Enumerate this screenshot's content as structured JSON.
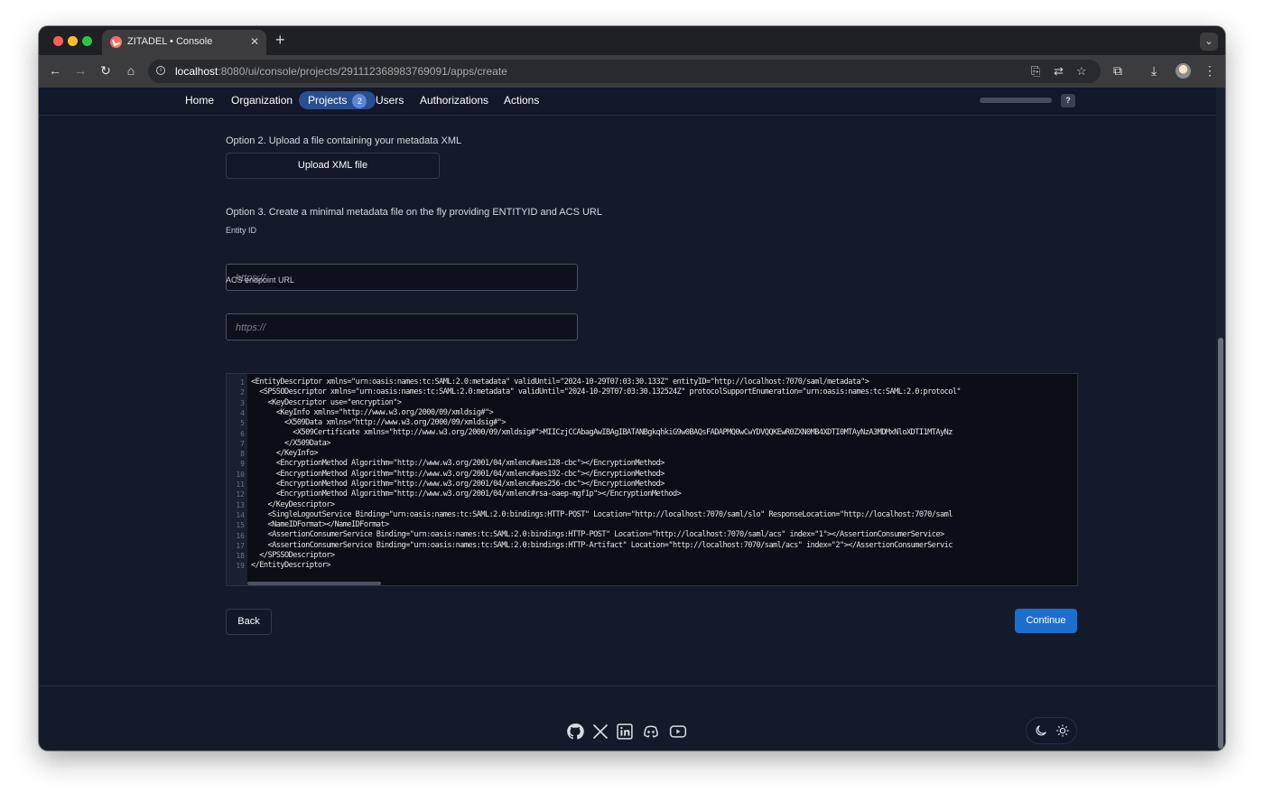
{
  "browser": {
    "tab_title": "ZITADEL • Console",
    "new_tab": "+",
    "url_host": "localhost",
    "url_path": ":8080/ui/console/projects/291112368983769091/apps/create"
  },
  "nav": {
    "items": [
      "Home",
      "Organization",
      "Projects",
      "Users",
      "Authorizations",
      "Actions"
    ],
    "projects_badge": "2",
    "help": "?"
  },
  "option2": {
    "label": "Option 2. Upload a file containing your metadata XML",
    "button": "Upload XML file"
  },
  "option3": {
    "label": "Option 3. Create a minimal metadata file on the fly providing ENTITYID and ACS URL",
    "entity_label": "Entity ID",
    "entity_placeholder": "https://",
    "acs_label": "ACS endpoint URL",
    "acs_placeholder": "https://"
  },
  "editor": {
    "line_numbers": [
      "1",
      "2",
      "3",
      "4",
      "5",
      "6",
      "7",
      "8",
      "9",
      "10",
      "11",
      "12",
      "13",
      "14",
      "15",
      "16",
      "17",
      "18",
      "19"
    ],
    "lines": [
      "<EntityDescriptor xmlns=\"urn:oasis:names:tc:SAML:2.0:metadata\" validUntil=\"2024-10-29T07:03:30.133Z\" entityID=\"http://localhost:7070/saml/metadata\">",
      "  <SPSSODescriptor xmlns=\"urn:oasis:names:tc:SAML:2.0:metadata\" validUntil=\"2024-10-29T07:03:30.132524Z\" protocolSupportEnumeration=\"urn:oasis:names:tc:SAML:2.0:protocol\"",
      "    <KeyDescriptor use=\"encryption\">",
      "      <KeyInfo xmlns=\"http://www.w3.org/2000/09/xmldsig#\">",
      "        <X509Data xmlns=\"http://www.w3.org/2000/09/xmldsig#\">",
      "          <X509Certificate xmlns=\"http://www.w3.org/2000/09/xmldsig#\">MIICzjCCAbagAwIBAgIBATANBgkqhkiG9w0BAQsFADAPMQ0wCwYDVQQKEwR0ZXN0MB4XDTI0MTAyNzA3MDMxNloXDTI1MTAyNz",
      "        </X509Data>",
      "      </KeyInfo>",
      "      <EncryptionMethod Algorithm=\"http://www.w3.org/2001/04/xmlenc#aes128-cbc\"></EncryptionMethod>",
      "      <EncryptionMethod Algorithm=\"http://www.w3.org/2001/04/xmlenc#aes192-cbc\"></EncryptionMethod>",
      "      <EncryptionMethod Algorithm=\"http://www.w3.org/2001/04/xmlenc#aes256-cbc\"></EncryptionMethod>",
      "      <EncryptionMethod Algorithm=\"http://www.w3.org/2001/04/xmlenc#rsa-oaep-mgf1p\"></EncryptionMethod>",
      "    </KeyDescriptor>",
      "    <SingleLogoutService Binding=\"urn:oasis:names:tc:SAML:2.0:bindings:HTTP-POST\" Location=\"http://localhost:7070/saml/slo\" ResponseLocation=\"http://localhost:7070/saml",
      "    <NameIDFormat></NameIDFormat>",
      "    <AssertionConsumerService Binding=\"urn:oasis:names:tc:SAML:2.0:bindings:HTTP-POST\" Location=\"http://localhost:7070/saml/acs\" index=\"1\"></AssertionConsumerService>",
      "    <AssertionConsumerService Binding=\"urn:oasis:names:tc:SAML:2.0:bindings:HTTP-Artifact\" Location=\"http://localhost:7070/saml/acs\" index=\"2\"></AssertionConsumerServic",
      "  </SPSSODescriptor>",
      "</EntityDescriptor>"
    ]
  },
  "actions": {
    "back": "Back",
    "continue": "Continue"
  },
  "footer": {
    "social_icons": [
      "github-icon",
      "x-icon",
      "linkedin-icon",
      "discord-icon",
      "youtube-icon"
    ],
    "theme_icons": [
      "moon-icon",
      "sun-icon"
    ]
  },
  "colors": {
    "page_bg": "#151a2b",
    "primary": "#1d6fcf",
    "nav_active": "#2a4f8f"
  }
}
